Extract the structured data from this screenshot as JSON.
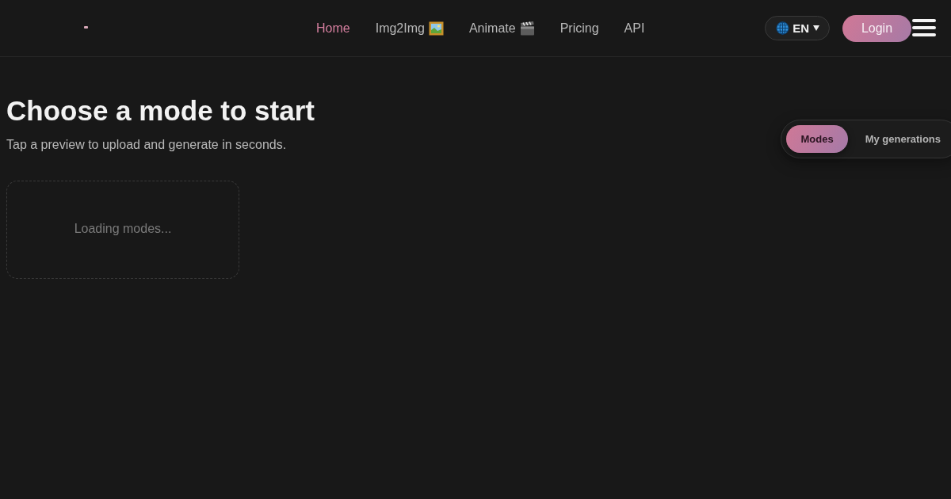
{
  "header": {
    "nav": [
      {
        "label": "Home",
        "selected": true,
        "kind": "text"
      },
      {
        "label": "Img2Img",
        "selected": false,
        "kind": "picture"
      },
      {
        "label": "Animate",
        "selected": false,
        "kind": "film"
      },
      {
        "label": "Pricing",
        "selected": false,
        "kind": "text"
      },
      {
        "label": "API",
        "selected": false,
        "kind": "text"
      }
    ],
    "language": "EN",
    "login": "Login"
  },
  "main": {
    "title": "Choose a mode to start",
    "subtitle": "Tap a preview to upload and generate in seconds.",
    "tabs": [
      {
        "label": "Modes",
        "selected": true
      },
      {
        "label": "My generations",
        "selected": false
      }
    ],
    "loading": "Loading modes..."
  }
}
